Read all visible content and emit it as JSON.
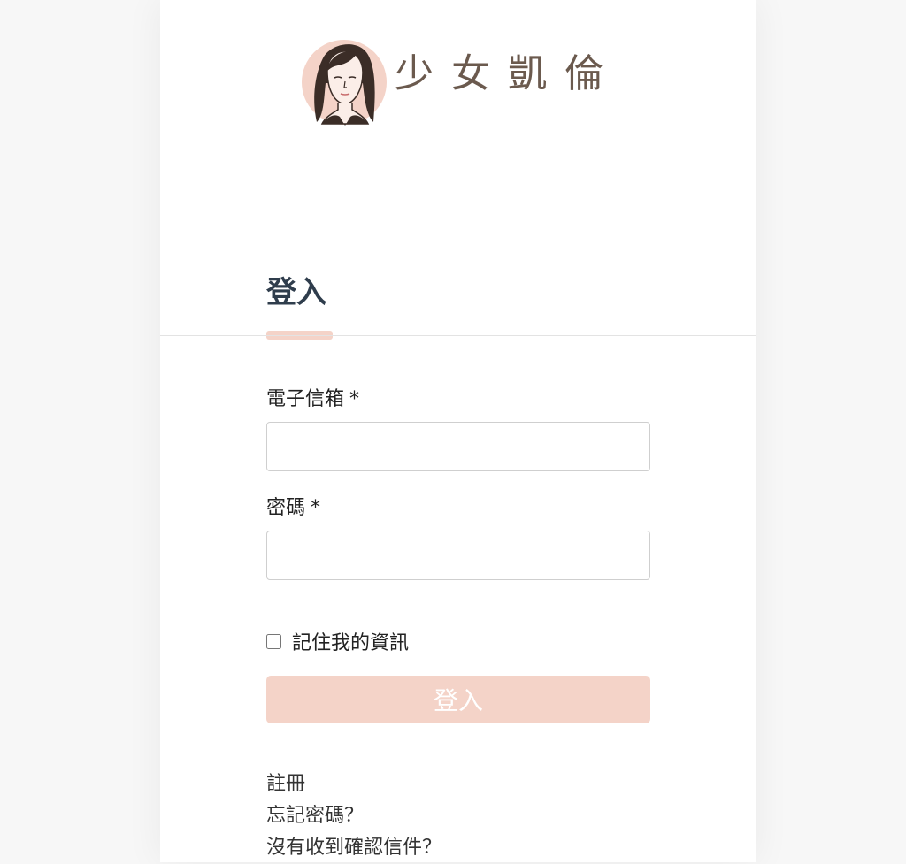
{
  "brand": {
    "name": "少女凱倫",
    "avatar_icon": "woman-portrait-icon"
  },
  "colors": {
    "accent": "#f4d3c8",
    "title": "#2f3d4c",
    "brand_text": "#6b5a4e"
  },
  "login": {
    "title": "登入",
    "email_label": "電子信箱",
    "password_label": "密碼",
    "required_mark": "*",
    "email_value": "",
    "password_value": "",
    "remember_label": "記住我的資訊",
    "remember_checked": false,
    "submit_label": "登入"
  },
  "links": {
    "register": "註冊",
    "forgot_password": "忘記密碼？",
    "resend_confirmation": "沒有收到確認信件？"
  }
}
